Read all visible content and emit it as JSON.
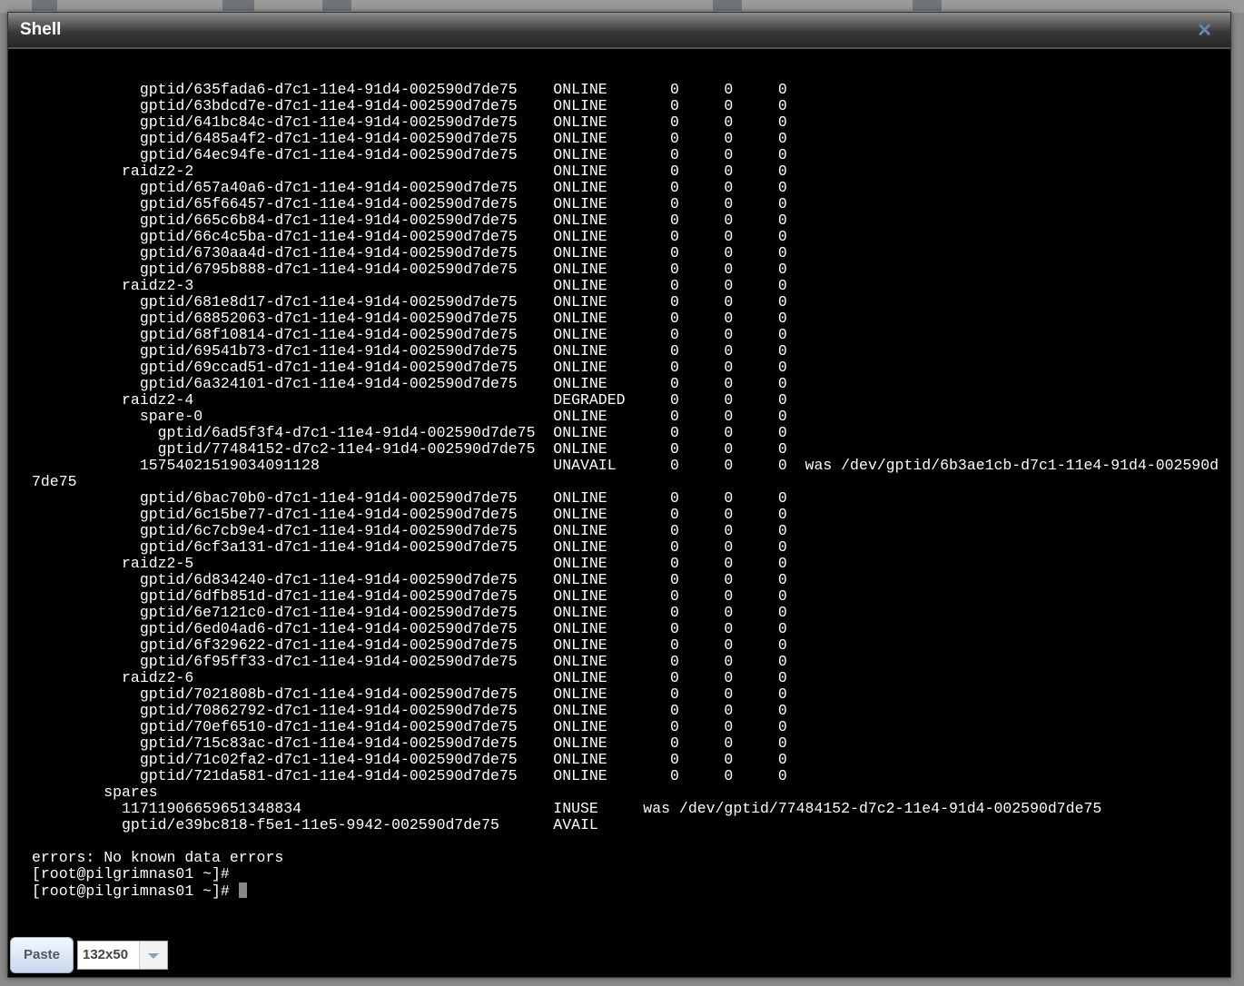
{
  "window": {
    "title": "Shell",
    "close_icon": "close-icon"
  },
  "terminal": {
    "rows": [
      {
        "i": 12,
        "n": "gptid/635fada6-d7c1-11e4-91d4-002590d7de75",
        "s": "ONLINE",
        "r": "0",
        "w": "0",
        "c": "0"
      },
      {
        "i": 12,
        "n": "gptid/63bdcd7e-d7c1-11e4-91d4-002590d7de75",
        "s": "ONLINE",
        "r": "0",
        "w": "0",
        "c": "0"
      },
      {
        "i": 12,
        "n": "gptid/641bc84c-d7c1-11e4-91d4-002590d7de75",
        "s": "ONLINE",
        "r": "0",
        "w": "0",
        "c": "0"
      },
      {
        "i": 12,
        "n": "gptid/6485a4f2-d7c1-11e4-91d4-002590d7de75",
        "s": "ONLINE",
        "r": "0",
        "w": "0",
        "c": "0"
      },
      {
        "i": 12,
        "n": "gptid/64ec94fe-d7c1-11e4-91d4-002590d7de75",
        "s": "ONLINE",
        "r": "0",
        "w": "0",
        "c": "0"
      },
      {
        "i": 10,
        "n": "raidz2-2",
        "s": "ONLINE",
        "r": "0",
        "w": "0",
        "c": "0"
      },
      {
        "i": 12,
        "n": "gptid/657a40a6-d7c1-11e4-91d4-002590d7de75",
        "s": "ONLINE",
        "r": "0",
        "w": "0",
        "c": "0"
      },
      {
        "i": 12,
        "n": "gptid/65f66457-d7c1-11e4-91d4-002590d7de75",
        "s": "ONLINE",
        "r": "0",
        "w": "0",
        "c": "0"
      },
      {
        "i": 12,
        "n": "gptid/665c6b84-d7c1-11e4-91d4-002590d7de75",
        "s": "ONLINE",
        "r": "0",
        "w": "0",
        "c": "0"
      },
      {
        "i": 12,
        "n": "gptid/66c4c5ba-d7c1-11e4-91d4-002590d7de75",
        "s": "ONLINE",
        "r": "0",
        "w": "0",
        "c": "0"
      },
      {
        "i": 12,
        "n": "gptid/6730aa4d-d7c1-11e4-91d4-002590d7de75",
        "s": "ONLINE",
        "r": "0",
        "w": "0",
        "c": "0"
      },
      {
        "i": 12,
        "n": "gptid/6795b888-d7c1-11e4-91d4-002590d7de75",
        "s": "ONLINE",
        "r": "0",
        "w": "0",
        "c": "0"
      },
      {
        "i": 10,
        "n": "raidz2-3",
        "s": "ONLINE",
        "r": "0",
        "w": "0",
        "c": "0"
      },
      {
        "i": 12,
        "n": "gptid/681e8d17-d7c1-11e4-91d4-002590d7de75",
        "s": "ONLINE",
        "r": "0",
        "w": "0",
        "c": "0"
      },
      {
        "i": 12,
        "n": "gptid/68852063-d7c1-11e4-91d4-002590d7de75",
        "s": "ONLINE",
        "r": "0",
        "w": "0",
        "c": "0"
      },
      {
        "i": 12,
        "n": "gptid/68f10814-d7c1-11e4-91d4-002590d7de75",
        "s": "ONLINE",
        "r": "0",
        "w": "0",
        "c": "0"
      },
      {
        "i": 12,
        "n": "gptid/69541b73-d7c1-11e4-91d4-002590d7de75",
        "s": "ONLINE",
        "r": "0",
        "w": "0",
        "c": "0"
      },
      {
        "i": 12,
        "n": "gptid/69ccad51-d7c1-11e4-91d4-002590d7de75",
        "s": "ONLINE",
        "r": "0",
        "w": "0",
        "c": "0"
      },
      {
        "i": 12,
        "n": "gptid/6a324101-d7c1-11e4-91d4-002590d7de75",
        "s": "ONLINE",
        "r": "0",
        "w": "0",
        "c": "0"
      },
      {
        "i": 10,
        "n": "raidz2-4",
        "s": "DEGRADED",
        "r": "0",
        "w": "0",
        "c": "0"
      },
      {
        "i": 12,
        "n": "spare-0",
        "s": "ONLINE",
        "r": "0",
        "w": "0",
        "c": "0"
      },
      {
        "i": 14,
        "n": "gptid/6ad5f3f4-d7c1-11e4-91d4-002590d7de75",
        "s": "ONLINE",
        "r": "0",
        "w": "0",
        "c": "0"
      },
      {
        "i": 14,
        "n": "gptid/77484152-d7c2-11e4-91d4-002590d7de75",
        "s": "ONLINE",
        "r": "0",
        "w": "0",
        "c": "0"
      },
      {
        "i": 12,
        "n": "15754021519034091128",
        "s": "UNAVAIL",
        "r": "0",
        "w": "0",
        "c": "0",
        "note": "was /dev/gptid/6b3ae1cb-d7c1-11e4-91d4-002590d"
      },
      {
        "raw": "7de75"
      },
      {
        "i": 12,
        "n": "gptid/6bac70b0-d7c1-11e4-91d4-002590d7de75",
        "s": "ONLINE",
        "r": "0",
        "w": "0",
        "c": "0"
      },
      {
        "i": 12,
        "n": "gptid/6c15be77-d7c1-11e4-91d4-002590d7de75",
        "s": "ONLINE",
        "r": "0",
        "w": "0",
        "c": "0"
      },
      {
        "i": 12,
        "n": "gptid/6c7cb9e4-d7c1-11e4-91d4-002590d7de75",
        "s": "ONLINE",
        "r": "0",
        "w": "0",
        "c": "0"
      },
      {
        "i": 12,
        "n": "gptid/6cf3a131-d7c1-11e4-91d4-002590d7de75",
        "s": "ONLINE",
        "r": "0",
        "w": "0",
        "c": "0"
      },
      {
        "i": 10,
        "n": "raidz2-5",
        "s": "ONLINE",
        "r": "0",
        "w": "0",
        "c": "0"
      },
      {
        "i": 12,
        "n": "gptid/6d834240-d7c1-11e4-91d4-002590d7de75",
        "s": "ONLINE",
        "r": "0",
        "w": "0",
        "c": "0"
      },
      {
        "i": 12,
        "n": "gptid/6dfb851d-d7c1-11e4-91d4-002590d7de75",
        "s": "ONLINE",
        "r": "0",
        "w": "0",
        "c": "0"
      },
      {
        "i": 12,
        "n": "gptid/6e7121c0-d7c1-11e4-91d4-002590d7de75",
        "s": "ONLINE",
        "r": "0",
        "w": "0",
        "c": "0"
      },
      {
        "i": 12,
        "n": "gptid/6ed04ad6-d7c1-11e4-91d4-002590d7de75",
        "s": "ONLINE",
        "r": "0",
        "w": "0",
        "c": "0"
      },
      {
        "i": 12,
        "n": "gptid/6f329622-d7c1-11e4-91d4-002590d7de75",
        "s": "ONLINE",
        "r": "0",
        "w": "0",
        "c": "0"
      },
      {
        "i": 12,
        "n": "gptid/6f95ff33-d7c1-11e4-91d4-002590d7de75",
        "s": "ONLINE",
        "r": "0",
        "w": "0",
        "c": "0"
      },
      {
        "i": 10,
        "n": "raidz2-6",
        "s": "ONLINE",
        "r": "0",
        "w": "0",
        "c": "0"
      },
      {
        "i": 12,
        "n": "gptid/7021808b-d7c1-11e4-91d4-002590d7de75",
        "s": "ONLINE",
        "r": "0",
        "w": "0",
        "c": "0"
      },
      {
        "i": 12,
        "n": "gptid/70862792-d7c1-11e4-91d4-002590d7de75",
        "s": "ONLINE",
        "r": "0",
        "w": "0",
        "c": "0"
      },
      {
        "i": 12,
        "n": "gptid/70ef6510-d7c1-11e4-91d4-002590d7de75",
        "s": "ONLINE",
        "r": "0",
        "w": "0",
        "c": "0"
      },
      {
        "i": 12,
        "n": "gptid/715c83ac-d7c1-11e4-91d4-002590d7de75",
        "s": "ONLINE",
        "r": "0",
        "w": "0",
        "c": "0"
      },
      {
        "i": 12,
        "n": "gptid/71c02fa2-d7c1-11e4-91d4-002590d7de75",
        "s": "ONLINE",
        "r": "0",
        "w": "0",
        "c": "0"
      },
      {
        "i": 12,
        "n": "gptid/721da581-d7c1-11e4-91d4-002590d7de75",
        "s": "ONLINE",
        "r": "0",
        "w": "0",
        "c": "0"
      },
      {
        "i": 8,
        "n": "spares"
      },
      {
        "i": 10,
        "n": "11711906659651348834",
        "s": "INUSE",
        "note": "was /dev/gptid/77484152-d7c2-11e4-91d4-002590d7de75"
      },
      {
        "i": 10,
        "n": "gptid/e39bc818-f5e1-11e5-9942-002590d7de75",
        "s": "AVAIL"
      },
      {
        "raw": ""
      },
      {
        "raw": "errors: No known data errors"
      },
      {
        "raw": "[root@pilgrimnas01 ~]#"
      },
      {
        "raw": "[root@pilgrimnas01 ~]# ",
        "cursor": true
      }
    ]
  },
  "toolbar": {
    "paste_label": "Paste",
    "size_value": "132x50"
  }
}
